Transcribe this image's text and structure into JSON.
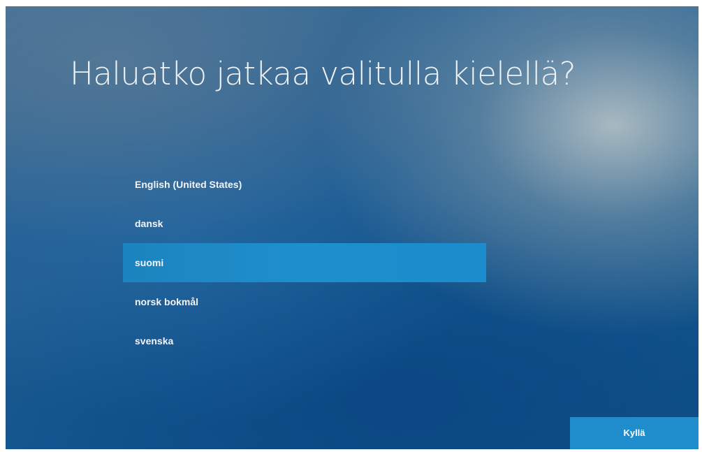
{
  "page": {
    "title": "Haluatko jatkaa valitulla kielellä?"
  },
  "languages": {
    "selected": "suomi",
    "items": [
      {
        "label": "English (United States)"
      },
      {
        "label": "dansk"
      },
      {
        "label": "suomi"
      },
      {
        "label": "norsk bokmål"
      },
      {
        "label": "svenska"
      }
    ]
  },
  "actions": {
    "next_label": "Kyllä"
  },
  "colors": {
    "background_primary": "#14578f",
    "selection_highlight": "#1e8fcc",
    "button_background": "#1f8ccb",
    "text": "#f2f6fa"
  }
}
